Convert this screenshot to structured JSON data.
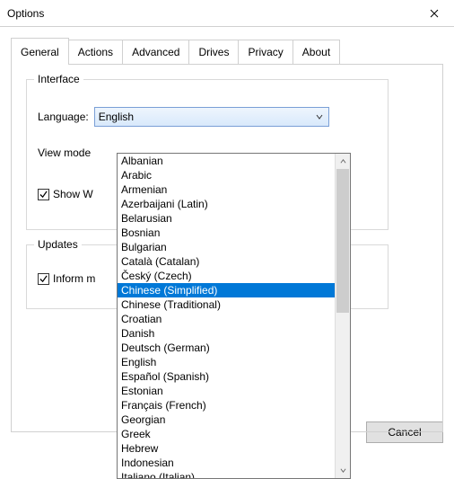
{
  "window": {
    "title": "Options",
    "close_icon": "close"
  },
  "tabs": [
    {
      "label": "General",
      "active": true
    },
    {
      "label": "Actions",
      "active": false
    },
    {
      "label": "Advanced",
      "active": false
    },
    {
      "label": "Drives",
      "active": false
    },
    {
      "label": "Privacy",
      "active": false
    },
    {
      "label": "About",
      "active": false
    }
  ],
  "interface_group": {
    "legend": "Interface",
    "language_label": "Language:",
    "language_value": "English",
    "view_mode_label": "View mode",
    "show_windows_label": "Show W"
  },
  "updates_group": {
    "legend": "Updates",
    "inform_label": "Inform m"
  },
  "language_options": {
    "selected_index": 10,
    "items": [
      "Albanian",
      "Arabic",
      "Armenian",
      "Azerbaijani (Latin)",
      "Belarusian",
      "Bosnian",
      "Bulgarian",
      "Català (Catalan)",
      "Český (Czech)",
      "Chinese (Simplified)",
      "Chinese (Traditional)",
      "Croatian",
      "Danish",
      "Deutsch (German)",
      "English",
      "Español (Spanish)",
      "Estonian",
      "Français (French)",
      "Georgian",
      "Greek",
      "Hebrew",
      "Indonesian",
      "Italiano (Italian)"
    ]
  },
  "buttons": {
    "cancel": "Cancel"
  },
  "colors": {
    "highlight": "#0078d7",
    "combo_border": "#7a9fd6"
  }
}
